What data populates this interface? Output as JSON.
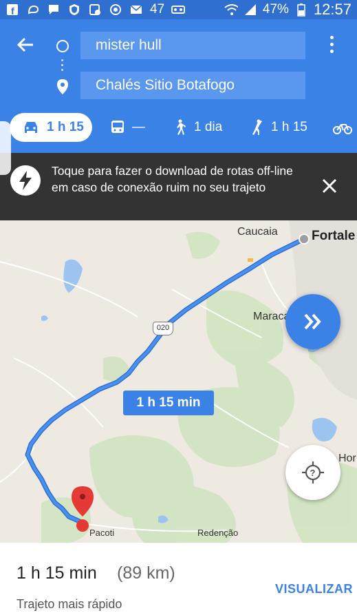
{
  "status_bar": {
    "notification_count": "47",
    "battery": "47%",
    "time": "12:57",
    "icons": [
      "facebook-icon",
      "message-icon",
      "chat-icon",
      "shield-icon",
      "screen-record-icon",
      "target-icon",
      "mail-icon",
      "voicemail-icon",
      "wifi-icon",
      "signal-icon",
      "battery-icon"
    ]
  },
  "header": {
    "origin": "mister hull",
    "destination": "Chalés Sitio Botafogo"
  },
  "modes": {
    "car": "1 h 15",
    "transit": "—",
    "walk": "1 dia",
    "ride": "1 h 15"
  },
  "banner": {
    "text": "Toque para fazer o download de rotas off-line em caso de conexão ruim no seu trajeto"
  },
  "map": {
    "places": {
      "caucaia": "Caucaia",
      "fortaleza": "Fortale",
      "maracanau": "Maracanaú",
      "pacoti": "Pacoti",
      "redencao": "Redenção",
      "hor": "Hor"
    },
    "route_shield": "020",
    "duration_label": "1 h 15 min",
    "colors": {
      "route": "#3b82e6",
      "green": "#cfe4c0",
      "water": "#9cc4f0",
      "pin": "#e53935"
    }
  },
  "sheet": {
    "duration": "1 h 15 min",
    "distance": "(89 km)",
    "subtitle": "Trajeto mais rápido",
    "action": "VISUALIZAR"
  }
}
